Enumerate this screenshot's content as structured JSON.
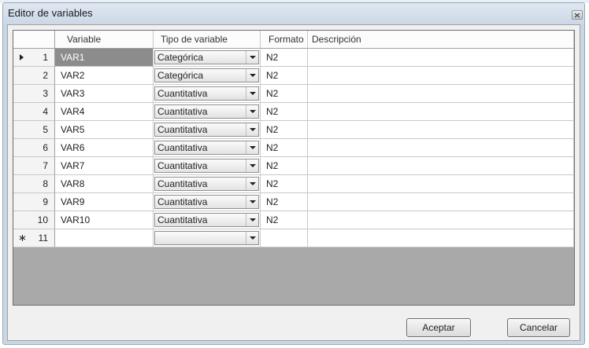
{
  "window": {
    "title": "Editor de variables"
  },
  "grid": {
    "columns": [
      "Variable",
      "Tipo de variable",
      "Formato",
      "Descripción"
    ],
    "rows": [
      {
        "num": "1",
        "variable": "VAR1",
        "tipo": "Categórica",
        "formato": "N2",
        "descripcion": ""
      },
      {
        "num": "2",
        "variable": "VAR2",
        "tipo": "Categórica",
        "formato": "N2",
        "descripcion": ""
      },
      {
        "num": "3",
        "variable": "VAR3",
        "tipo": "Cuantitativa",
        "formato": "N2",
        "descripcion": ""
      },
      {
        "num": "4",
        "variable": "VAR4",
        "tipo": "Cuantitativa",
        "formato": "N2",
        "descripcion": ""
      },
      {
        "num": "5",
        "variable": "VAR5",
        "tipo": "Cuantitativa",
        "formato": "N2",
        "descripcion": ""
      },
      {
        "num": "6",
        "variable": "VAR6",
        "tipo": "Cuantitativa",
        "formato": "N2",
        "descripcion": ""
      },
      {
        "num": "7",
        "variable": "VAR7",
        "tipo": "Cuantitativa",
        "formato": "N2",
        "descripcion": ""
      },
      {
        "num": "8",
        "variable": "VAR8",
        "tipo": "Cuantitativa",
        "formato": "N2",
        "descripcion": ""
      },
      {
        "num": "9",
        "variable": "VAR9",
        "tipo": "Cuantitativa",
        "formato": "N2",
        "descripcion": ""
      },
      {
        "num": "10",
        "variable": "VAR10",
        "tipo": "Cuantitativa",
        "formato": "N2",
        "descripcion": ""
      }
    ],
    "new_row": {
      "num": "11",
      "variable": "",
      "tipo": "",
      "formato": "",
      "descripcion": ""
    }
  },
  "buttons": {
    "ok": "Aceptar",
    "cancel": "Cancelar"
  },
  "icons": {
    "close": "close-icon",
    "current_row": "current-row-arrow-icon",
    "new_row": "new-row-star-icon",
    "dropdown": "chevron-down-icon"
  }
}
